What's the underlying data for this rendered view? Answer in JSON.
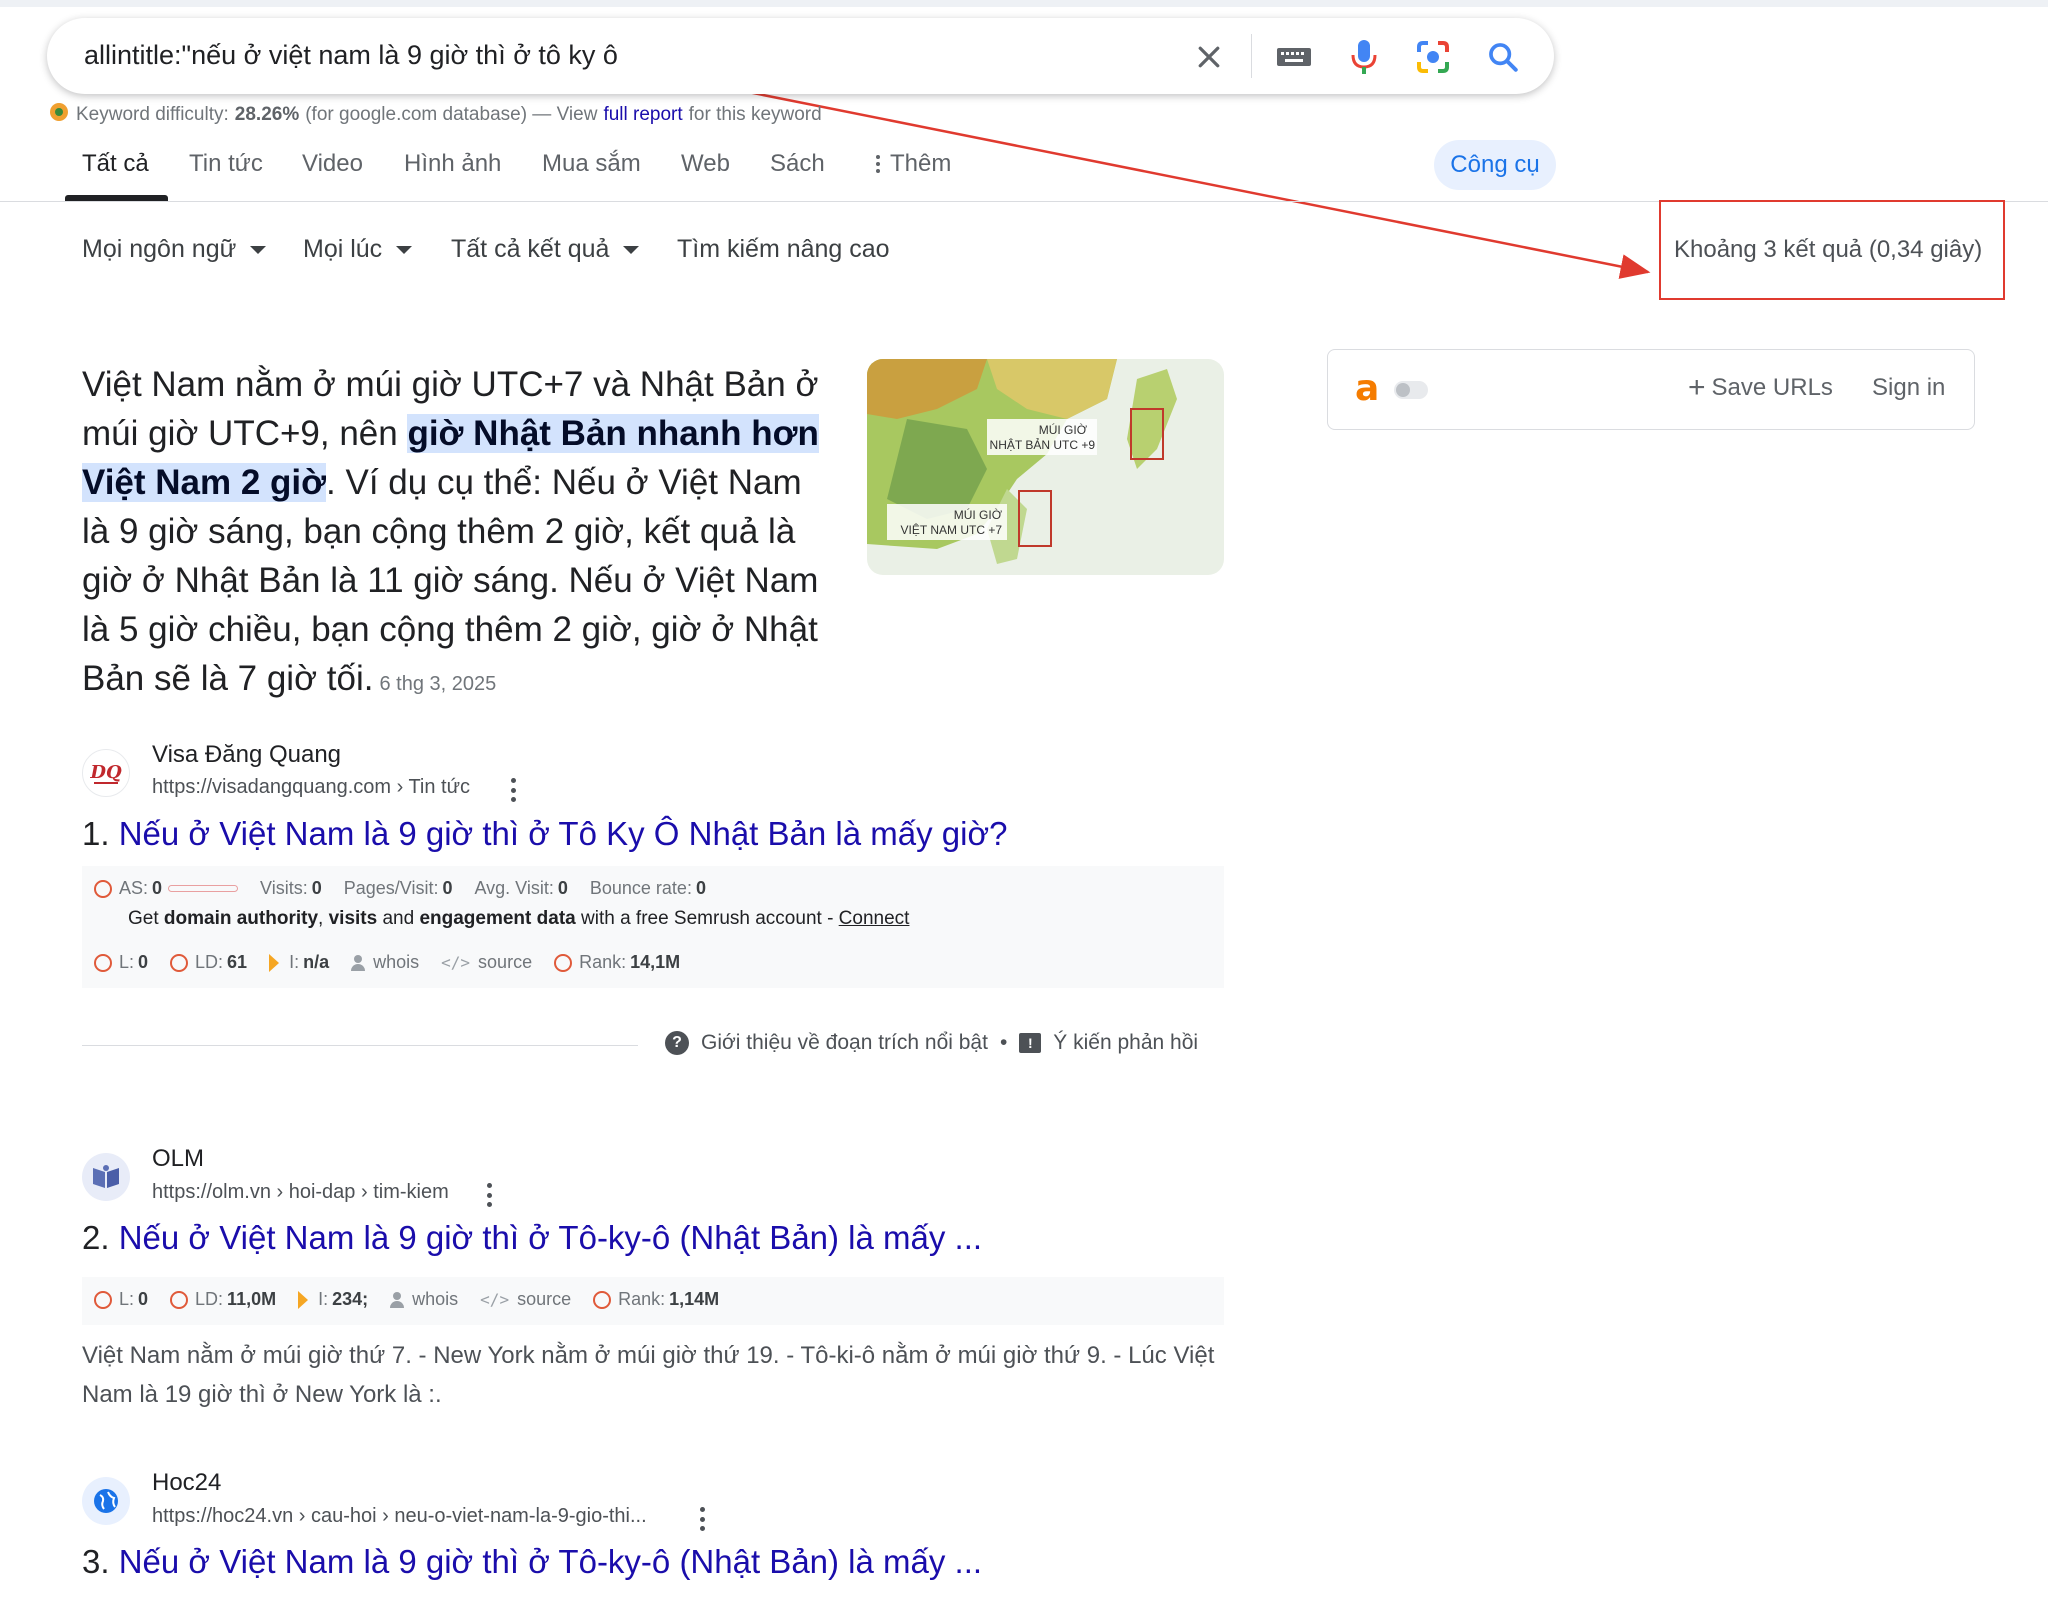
{
  "search": {
    "query": "allintitle:\"nếu ở việt nam là 9 giờ thì ở tô ky ô",
    "icons": [
      "close-icon",
      "keyboard-icon",
      "microphone-icon",
      "lens-icon",
      "search-icon"
    ]
  },
  "keyword_difficulty": {
    "label": "Keyword difficulty:",
    "value": "28.26%",
    "db_note": "(for google.com database) — View",
    "link": "full report",
    "tail": "for this keyword"
  },
  "tabs": [
    "Tất cả",
    "Tin tức",
    "Video",
    "Hình ảnh",
    "Mua sắm",
    "Web",
    "Sách",
    "Thêm"
  ],
  "tools_label": "Công cụ",
  "filters": {
    "language": "Mọi ngôn ngữ",
    "time": "Mọi lúc",
    "results": "Tất cả kết quả",
    "advanced": "Tìm kiếm nâng cao"
  },
  "result_stats": "Khoảng 3 kết quả (0,34 giây)",
  "snippet": {
    "text_before": "Việt Nam nằm ở múi giờ UTC+7 và Nhật Bản ở múi giờ UTC+9, nên ",
    "highlight": "giờ Nhật Bản nhanh hơn Việt Nam 2 giờ",
    "text_after": ". Ví dụ cụ thể: Nếu ở Việt Nam là 9 giờ sáng, bạn cộng thêm 2 giờ, kết quả là giờ ở Nhật Bản là 11 giờ sáng. Nếu ở Việt Nam là 5 giờ chiều, bạn cộng thêm 2 giờ, giờ ở Nhật Bản sẽ là 7 giờ tối.",
    "date": "6 thg 3, 2025",
    "image_labels": {
      "japan": "MÚI GIỜ NHẬT BẢN UTC +9",
      "japan_line1": "MÚI GIỜ",
      "japan_line2": "NHẬT BẢN UTC +9",
      "vietnam_line1": "MÚI GIỜ",
      "vietnam_line2": "VIỆT NAM UTC +7"
    }
  },
  "widget": {
    "logo": "a",
    "save": "Save URLs",
    "signin": "Sign in"
  },
  "results": [
    {
      "site": "Visa Đăng Quang",
      "url": "https://visadangquang.com › Tin tức",
      "num": "1.",
      "title": "Nếu ở Việt Nam là 9 giờ thì ở Tô Ky Ô Nhật Bản là mấy giờ?",
      "favicon_text": "DQ",
      "seo1": {
        "as_label": "AS:",
        "as": "0",
        "visits_label": "Visits:",
        "visits": "0",
        "ppv_label": "Pages/Visit:",
        "ppv": "0",
        "avg_label": "Avg. Visit:",
        "avg": "0",
        "bounce_label": "Bounce rate:",
        "bounce": "0"
      },
      "get_line": {
        "pre": "Get",
        "b1": "domain authority",
        "sep1": ",",
        "b2": "visits",
        "mid": "and",
        "b3": "engagement data",
        "post": "with a free Semrush account -",
        "link": "Connect"
      },
      "seo2": {
        "l_label": "L:",
        "l": "0",
        "ld_label": "LD:",
        "ld": "61",
        "i_label": "I:",
        "i": "n/a",
        "whois": "whois",
        "source": "source",
        "rank_label": "Rank:",
        "rank": "14,1M"
      }
    },
    {
      "site": "OLM",
      "url": "https://olm.vn › hoi-dap › tim-kiem",
      "num": "2.",
      "title": "Nếu ở Việt Nam là 9 giờ thì ở Tô-ky-ô (Nhật Bản) là mấy ...",
      "seo2": {
        "l_label": "L:",
        "l": "0",
        "ld_label": "LD:",
        "ld": "11,0M",
        "i_label": "I:",
        "i": "234;",
        "whois": "whois",
        "source": "source",
        "rank_label": "Rank:",
        "rank": "1,14M"
      },
      "snippet": "Việt Nam nằm ở múi giờ thứ 7. - New York nằm ở múi giờ thứ 19. - Tô-ki-ô nằm ở múi giờ thứ 9. - Lúc Việt Nam là 19 giờ thì ở New York là :."
    },
    {
      "site": "Hoc24",
      "url": "https://hoc24.vn › cau-hoi › neu-o-viet-nam-la-9-gio-thi...",
      "num": "3.",
      "title": "Nếu ở Việt Nam là 9 giờ thì ở Tô-ky-ô (Nhật Bản) là mấy ..."
    }
  ],
  "about_featured": "Giới thiệu về đoạn trích nổi bật",
  "bullet": "•",
  "feedback": "Ý kiến phản hồi",
  "colors": {
    "link": "#1a0dab",
    "accent": "#1a73e8",
    "annotation": "#e03a2f",
    "highlight": "#d3e3fd"
  }
}
